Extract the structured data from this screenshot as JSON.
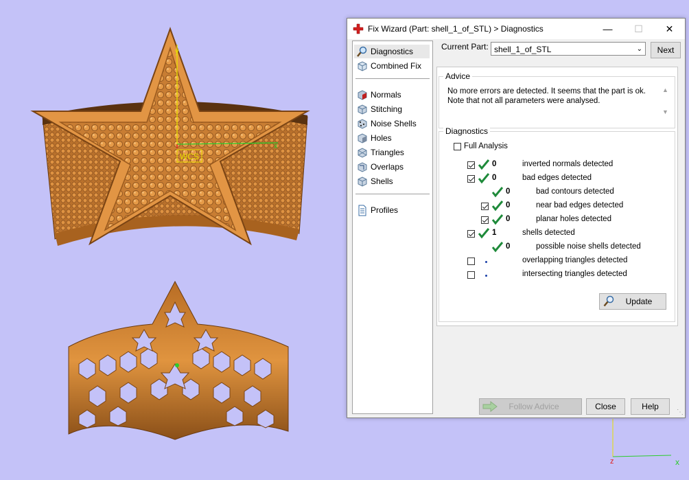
{
  "viewport": {
    "wcs_label": "WCS",
    "axis_y": "y",
    "axis_x": "x",
    "axis_z": "z"
  },
  "dialog": {
    "title": "Fix Wizard (Part: shell_1_of_STL) > Diagnostics",
    "controls": {
      "minimize": "—",
      "maximize": "☐",
      "close": "✕"
    }
  },
  "nav": {
    "items": [
      {
        "label": "Diagnostics",
        "icon": "magnifier-icon",
        "selected": true
      },
      {
        "label": "Combined Fix",
        "icon": "cube-icon"
      },
      {
        "label": "Normals",
        "icon": "normals-cube-icon"
      },
      {
        "label": "Stitching",
        "icon": "stitching-cube-icon"
      },
      {
        "label": "Noise Shells",
        "icon": "noise-cube-icon"
      },
      {
        "label": "Holes",
        "icon": "holes-cube-icon"
      },
      {
        "label": "Triangles",
        "icon": "triangles-cube-icon"
      },
      {
        "label": "Overlaps",
        "icon": "overlaps-cube-icon"
      },
      {
        "label": "Shells",
        "icon": "shells-cube-icon"
      },
      {
        "label": "Profiles",
        "icon": "document-icon"
      }
    ]
  },
  "current_part": {
    "label": "Current Part:",
    "value": "shell_1_of_STL"
  },
  "buttons": {
    "next": "Next",
    "update": "Update",
    "follow_advice": "Follow Advice",
    "close": "Close",
    "help": "Help"
  },
  "advice": {
    "title": "Advice",
    "text": "No more errors are detected. It seems that the part is ok.\nNote that not all parameters were analysed."
  },
  "diagnostics": {
    "title": "Diagnostics",
    "full_analysis": "Full Analysis",
    "rows": [
      {
        "label": "inverted normals detected",
        "count": "0",
        "checked": true,
        "ok": true,
        "indent": 0
      },
      {
        "label": "bad edges detected",
        "count": "0",
        "checked": true,
        "ok": true,
        "indent": 0
      },
      {
        "label": "bad contours detected",
        "count": "0",
        "checked": null,
        "ok": true,
        "indent": 1
      },
      {
        "label": "near bad edges detected",
        "count": "0",
        "checked": true,
        "ok": true,
        "indent": 1
      },
      {
        "label": "planar holes detected",
        "count": "0",
        "checked": true,
        "ok": true,
        "indent": 1
      },
      {
        "label": "shells detected",
        "count": "1",
        "checked": true,
        "ok": true,
        "indent": 0
      },
      {
        "label": "possible noise shells detected",
        "count": "0",
        "checked": null,
        "ok": true,
        "indent": 1
      },
      {
        "label": "overlapping triangles detected",
        "count": "",
        "checked": false,
        "ok": false,
        "indent": 0
      },
      {
        "label": "intersecting triangles detected",
        "count": "",
        "checked": false,
        "ok": false,
        "indent": 0
      }
    ]
  },
  "colors": {
    "background": "#c4c2f8",
    "model": "#d98a3a",
    "check_green": "#1e8a3a"
  }
}
